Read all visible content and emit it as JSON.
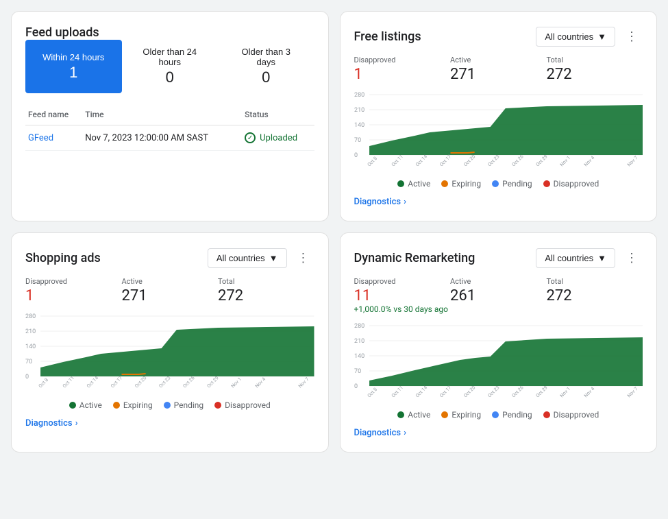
{
  "feed_uploads": {
    "title": "Feed uploads",
    "filters": [
      {
        "label": "Within 24 hours",
        "count": "1",
        "active": true
      },
      {
        "label": "Older than 24 hours",
        "count": "0",
        "active": false
      },
      {
        "label": "Older than 3 days",
        "count": "0",
        "active": false
      }
    ],
    "table": {
      "columns": [
        "Feed name",
        "Time",
        "Status"
      ],
      "rows": [
        {
          "feed_name": "GFeed",
          "time": "Nov 7, 2023 12:00:00 AM SAST",
          "status": "Uploaded"
        }
      ]
    }
  },
  "free_listings": {
    "title": "Free listings",
    "countries_label": "All countries",
    "stats": {
      "disapproved_label": "Disapproved",
      "disapproved_value": "1",
      "active_label": "Active",
      "active_value": "271",
      "total_label": "Total",
      "total_value": "272"
    },
    "chart": {
      "y_labels": [
        "280",
        "210",
        "140",
        "70",
        "0"
      ],
      "x_labels": [
        "Oct 8",
        "Oct 11",
        "Oct 14",
        "Oct 17",
        "Oct 20",
        "Oct 23",
        "Oct 26",
        "Oct 29",
        "Nov 1",
        "Nov 4",
        "Nov 7"
      ]
    },
    "legend": [
      {
        "label": "Active",
        "color": "#137333"
      },
      {
        "label": "Expiring",
        "color": "#e37400"
      },
      {
        "label": "Pending",
        "color": "#4285f4"
      },
      {
        "label": "Disapproved",
        "color": "#d93025"
      }
    ],
    "diagnostics_label": "Diagnostics"
  },
  "shopping_ads": {
    "title": "Shopping ads",
    "countries_label": "All countries",
    "stats": {
      "disapproved_label": "Disapproved",
      "disapproved_value": "1",
      "active_label": "Active",
      "active_value": "271",
      "total_label": "Total",
      "total_value": "272"
    },
    "chart": {
      "y_labels": [
        "280",
        "210",
        "140",
        "70",
        "0"
      ],
      "x_labels": [
        "Oct 8",
        "Oct 11",
        "Oct 14",
        "Oct 17",
        "Oct 20",
        "Oct 23",
        "Oct 26",
        "Oct 29",
        "Nov 1",
        "Nov 4",
        "Nov 7"
      ]
    },
    "legend": [
      {
        "label": "Active",
        "color": "#137333"
      },
      {
        "label": "Expiring",
        "color": "#e37400"
      },
      {
        "label": "Pending",
        "color": "#4285f4"
      },
      {
        "label": "Disapproved",
        "color": "#d93025"
      }
    ],
    "diagnostics_label": "Diagnostics"
  },
  "dynamic_remarketing": {
    "title": "Dynamic Remarketing",
    "countries_label": "All countries",
    "stats": {
      "disapproved_label": "Disapproved",
      "disapproved_value": "11",
      "active_label": "Active",
      "active_value": "261",
      "total_label": "Total",
      "total_value": "272",
      "change": "+1,000.0% vs 30 days ago"
    },
    "chart": {
      "y_labels": [
        "280",
        "210",
        "140",
        "70",
        "0"
      ],
      "x_labels": [
        "Oct 8",
        "Oct 11",
        "Oct 14",
        "Oct 17",
        "Oct 20",
        "Oct 23",
        "Oct 26",
        "Oct 29",
        "Nov 1",
        "Nov 4",
        "Nov 7"
      ]
    },
    "legend": [
      {
        "label": "Active",
        "color": "#137333"
      },
      {
        "label": "Expiring",
        "color": "#e37400"
      },
      {
        "label": "Pending",
        "color": "#4285f4"
      },
      {
        "label": "Disapproved",
        "color": "#d93025"
      }
    ],
    "diagnostics_label": "Diagnostics"
  }
}
